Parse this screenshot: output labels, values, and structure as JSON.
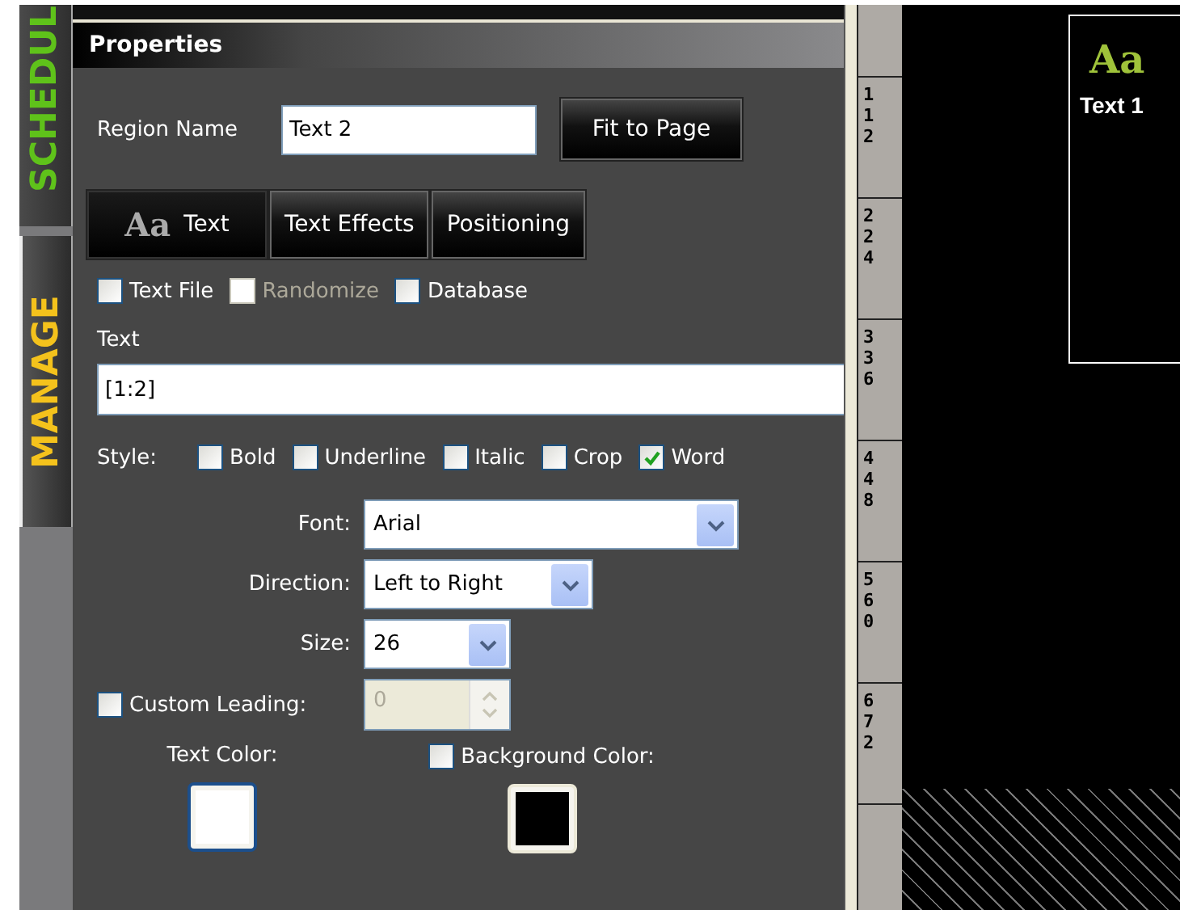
{
  "side_tabs": [
    {
      "label": "SCHEDUL",
      "selected": false
    },
    {
      "label": "MANAGE",
      "selected": true
    }
  ],
  "properties": {
    "title": "Properties",
    "region_name": {
      "label": "Region Name",
      "value": "Text 2"
    },
    "fit_button": "Fit to Page",
    "tabs": [
      {
        "label": "Text",
        "icon": "Aa",
        "selected": true
      },
      {
        "label": "Text Effects",
        "selected": false
      },
      {
        "label": "Positioning",
        "selected": false
      }
    ],
    "sources": [
      {
        "label": "Text File",
        "checked": false,
        "disabled": false
      },
      {
        "label": "Randomize",
        "checked": false,
        "disabled": true
      },
      {
        "label": "Database",
        "checked": false,
        "disabled": false
      }
    ],
    "text": {
      "label": "Text",
      "value": "[1:2]"
    },
    "style": {
      "label": "Style:",
      "options": [
        {
          "label": "Bold",
          "checked": false
        },
        {
          "label": "Underline",
          "checked": false
        },
        {
          "label": "Italic",
          "checked": false
        },
        {
          "label": "Crop",
          "checked": false
        },
        {
          "label": "Word",
          "checked": true
        }
      ]
    },
    "selects": [
      {
        "label": "Font:",
        "value": "Arial"
      },
      {
        "label": "Direction:",
        "value": "Left to Right"
      },
      {
        "label": "Size:",
        "value": "26"
      }
    ],
    "custom_leading": {
      "label": "Custom Leading:",
      "checked": false,
      "value": "0",
      "disabled": true
    },
    "text_color": {
      "label": "Text Color:",
      "color": "#ffffff"
    },
    "background_color": {
      "label": "Background Color:",
      "checked": false,
      "color": "#000000"
    }
  },
  "ruler": [
    "112",
    "224",
    "336",
    "448",
    "560",
    "672"
  ],
  "canvas": {
    "regions": [
      {
        "label": "Text 1",
        "icon": "Aa"
      }
    ]
  }
}
